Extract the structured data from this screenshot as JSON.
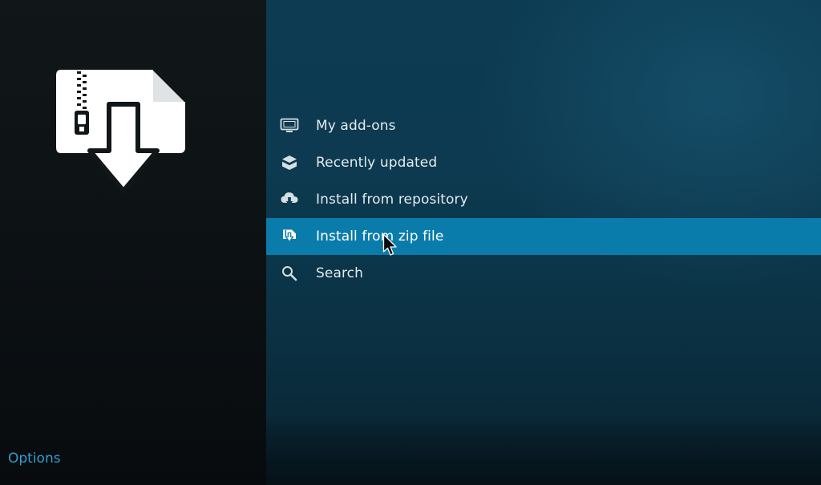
{
  "menu": {
    "items": [
      {
        "label": "My add-ons",
        "icon": "monitor-icon",
        "focused": false
      },
      {
        "label": "Recently updated",
        "icon": "box-icon",
        "focused": false
      },
      {
        "label": "Install from repository",
        "icon": "cloud-download-icon",
        "focused": false
      },
      {
        "label": "Install from zip file",
        "icon": "zip-install-icon",
        "focused": true
      },
      {
        "label": "Search",
        "icon": "search-icon",
        "focused": false
      }
    ]
  },
  "footer": {
    "options_label": "Options"
  },
  "preview": {
    "icon": "zip-file-download-icon"
  },
  "colors": {
    "focus_bar": "#0a7cab",
    "options_text": "#2f9fd0",
    "menu_text": "#e3ebef",
    "right_panel_bg": "#0c3b52",
    "left_panel_bg": "#111719"
  }
}
